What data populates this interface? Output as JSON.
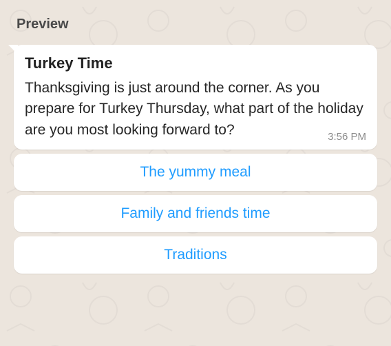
{
  "preview_label": "Preview",
  "message": {
    "title": "Turkey Time",
    "body": "Thanksgiving is just around the corner. As you prepare for Turkey Thursday, what part of the holiday are you most looking forward to?",
    "timestamp": "3:56 PM"
  },
  "options": [
    {
      "label": "The yummy meal"
    },
    {
      "label": "Family and friends time"
    },
    {
      "label": "Traditions"
    }
  ]
}
